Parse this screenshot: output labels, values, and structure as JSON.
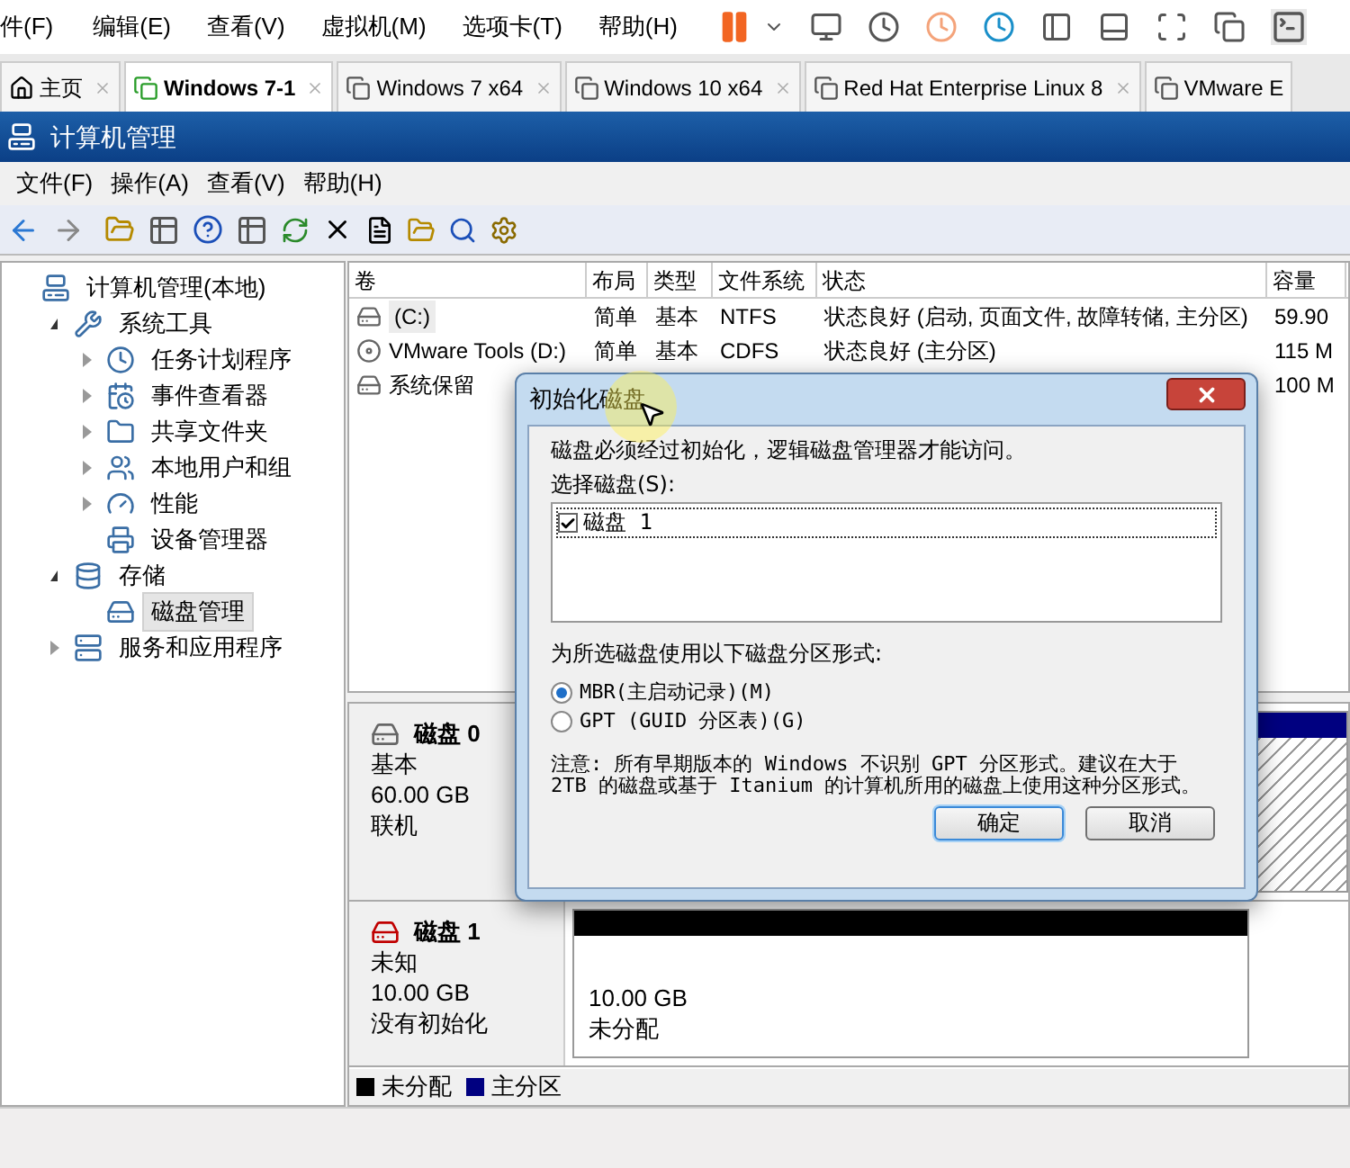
{
  "vmware": {
    "menu": [
      "件(F)",
      "编辑(E)",
      "查看(V)",
      "虚拟机(M)",
      "选项卡(T)",
      "帮助(H)"
    ],
    "tabs": [
      {
        "label": "主页",
        "kind": "home",
        "selected": false
      },
      {
        "label": "Windows 7-1",
        "kind": "vm",
        "selected": true
      },
      {
        "label": "Windows 7 x64",
        "kind": "vm",
        "selected": false
      },
      {
        "label": "Windows 10 x64",
        "kind": "vm",
        "selected": false
      },
      {
        "label": "Red Hat Enterprise Linux 8",
        "kind": "vm",
        "selected": false
      },
      {
        "label": "VMware E",
        "kind": "vm",
        "selected": false
      }
    ]
  },
  "window": {
    "title": "计算机管理"
  },
  "menu": [
    "文件(F)",
    "操作(A)",
    "查看(V)",
    "帮助(H)"
  ],
  "tree": {
    "label": "计算机管理(本地)",
    "kind": "computer",
    "selected": false,
    "children": [
      {
        "label": "系统工具",
        "kind": "tools",
        "expanded": true,
        "selected": false,
        "children": [
          {
            "label": "任务计划程序",
            "kind": "clock",
            "expanded": false,
            "selected": false
          },
          {
            "label": "事件查看器",
            "kind": "event",
            "expanded": false,
            "selected": false
          },
          {
            "label": "共享文件夹",
            "kind": "folder",
            "expanded": false,
            "selected": false
          },
          {
            "label": "本地用户和组",
            "kind": "users",
            "expanded": false,
            "selected": false
          },
          {
            "label": "性能",
            "kind": "gauge",
            "expanded": false,
            "selected": false
          },
          {
            "label": "设备管理器",
            "kind": "device",
            "selected": false
          }
        ]
      },
      {
        "label": "存储",
        "kind": "storage",
        "expanded": true,
        "selected": false,
        "children": [
          {
            "label": "磁盘管理",
            "kind": "disk",
            "selected": true
          }
        ]
      },
      {
        "label": "服务和应用程序",
        "kind": "services",
        "expanded": false,
        "selected": false
      }
    ]
  },
  "table": {
    "columns": [
      "卷",
      "布局",
      "类型",
      "文件系统",
      "状态",
      "容量"
    ],
    "rows": [
      {
        "kind": "disk",
        "selected": true,
        "volume": "(C:)",
        "layout": "简单",
        "type": "基本",
        "fs": "NTFS",
        "status": "状态良好 (启动, 页面文件, 故障转储, 主分区)",
        "capacity": "59.90"
      },
      {
        "kind": "cdrom",
        "selected": false,
        "volume": "VMware Tools (D:)",
        "layout": "简单",
        "type": "基本",
        "fs": "CDFS",
        "status": "状态良好 (主分区)",
        "capacity": "115 M"
      },
      {
        "kind": "disk",
        "selected": false,
        "volume": "系统保留",
        "capacity": "100 M"
      }
    ]
  },
  "disks": [
    {
      "name": "磁盘 0",
      "kind": "online",
      "type": "基本",
      "size": "60.00 GB",
      "status": "联机",
      "partitions": [
        {
          "color": "#000080",
          "selected": true
        }
      ]
    },
    {
      "name": "磁盘 1",
      "kind": "uninitialized",
      "type": "未知",
      "size": "10.00 GB",
      "status": "没有初始化",
      "partitions": [
        {
          "color": "#000000",
          "selected": false,
          "size": "10.00 GB",
          "label": "未分配"
        }
      ]
    }
  ],
  "legend": [
    {
      "label": "未分配",
      "color": "#000000"
    },
    {
      "label": "主分区",
      "color": "#000080"
    }
  ],
  "dialog": {
    "title": "初始化磁盘",
    "message": "磁盘必须经过初始化，逻辑磁盘管理器才能访问。",
    "select_label": "选择磁盘(S):",
    "disks": [
      {
        "label": "磁盘 1",
        "checked": true
      }
    ],
    "format_label": "为所选磁盘使用以下磁盘分区形式:",
    "formats": [
      {
        "label": "MBR(主启动记录)(M)",
        "selected": true
      },
      {
        "label": "GPT (GUID 分区表)(G)",
        "selected": false
      }
    ],
    "note": "注意: 所有早期版本的 Windows 不识别 GPT 分区形式。建议在大于 2TB 的磁盘或基于 Itanium 的计算机所用的磁盘上使用这种分区形式。",
    "buttons": [
      {
        "label": "确定",
        "default": true
      },
      {
        "label": "取消",
        "default": false
      }
    ]
  }
}
